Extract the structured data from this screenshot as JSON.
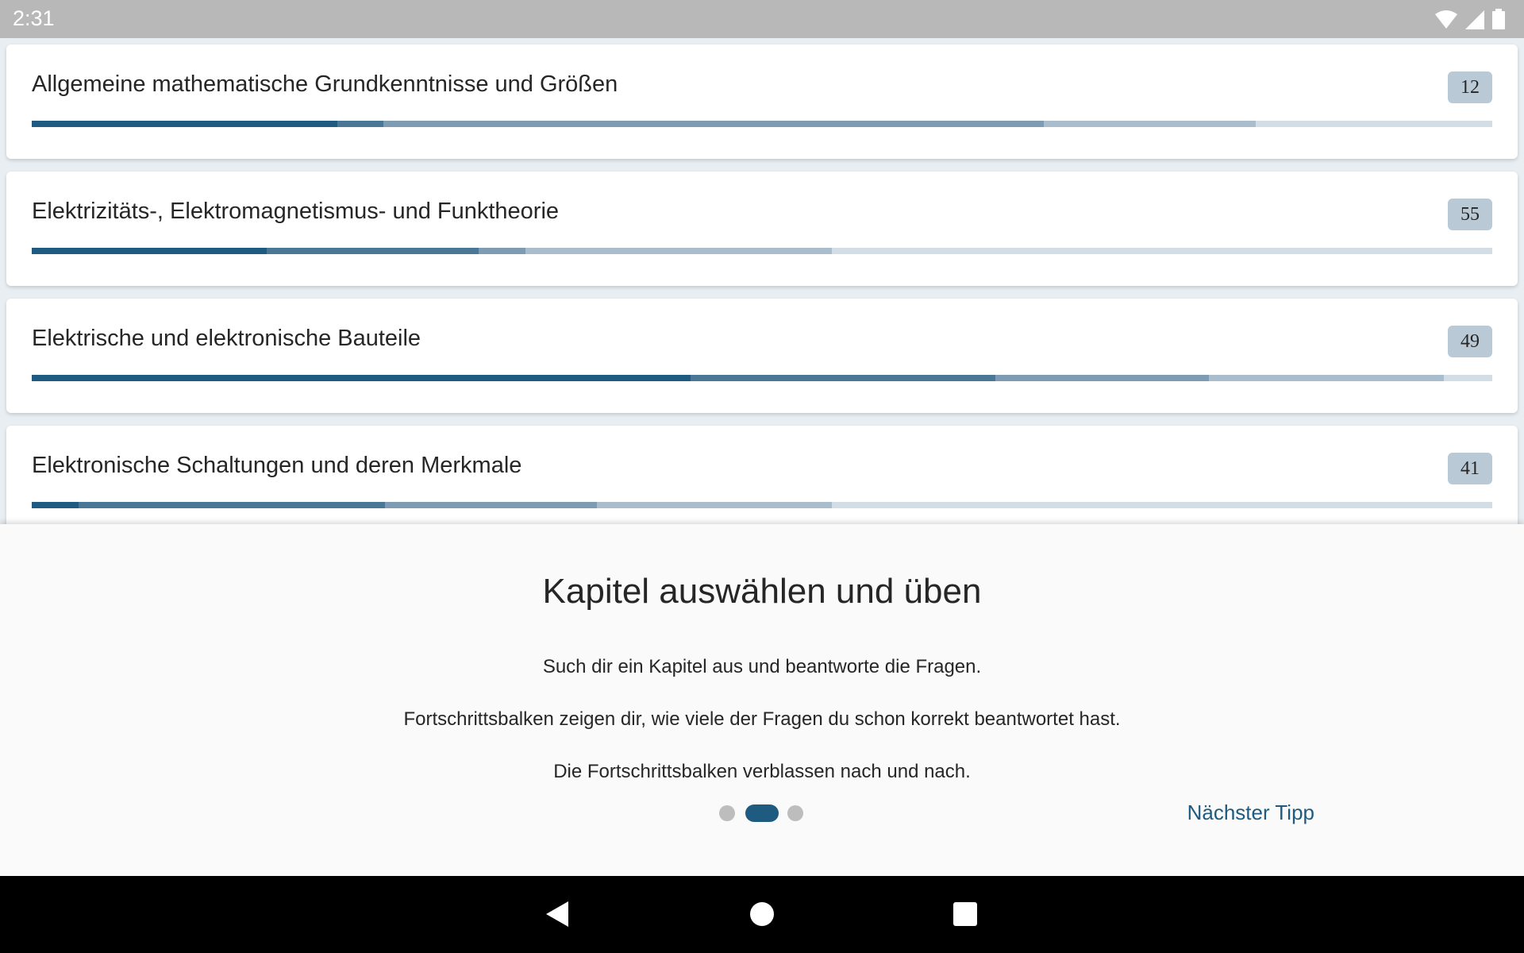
{
  "status_bar": {
    "time": "2:31",
    "icons": [
      "wifi-icon",
      "signal-icon",
      "battery-icon"
    ]
  },
  "chapters": [
    {
      "title": "Allgemeine mathematische Grundkenntnisse und Größen",
      "count": "12",
      "progress_fractions": [
        0.209,
        0.032,
        0.452,
        0.145,
        0.162
      ]
    },
    {
      "title": "Elektrizitäts-, Elektromagnetismus- und Funktheorie",
      "count": "55",
      "progress_fractions": [
        0.161,
        0.145,
        0.032,
        0.21,
        0.452
      ]
    },
    {
      "title": "Elektrische und elektronische Bauteile",
      "count": "49",
      "progress_fractions": [
        0.451,
        0.209,
        0.146,
        0.161,
        0.033
      ]
    },
    {
      "title": "Elektronische Schaltungen und deren Merkmale",
      "count": "41",
      "progress_fractions": [
        0.032,
        0.21,
        0.145,
        0.161,
        0.452
      ]
    }
  ],
  "progress_colors": [
    "#1f5a80",
    "#4a7796",
    "#7d9cb3",
    "#a9bdcc",
    "#d3dde6"
  ],
  "tip": {
    "title": "Kapitel auswählen und üben",
    "lines": [
      "Such dir ein Kapitel aus und beantworte die Fragen.",
      "Fortschrittsbalken zeigen dir, wie viele der Fragen du schon korrekt beantwortet hast.",
      "Die Fortschrittsbalken verblassen nach und nach."
    ],
    "page_count": 3,
    "active_page": 2,
    "next_label": "Nächster Tipp"
  },
  "colors": {
    "accent": "#1f5a80",
    "badge": "#b9c9d6",
    "status_bar": "#b8b8b8"
  }
}
